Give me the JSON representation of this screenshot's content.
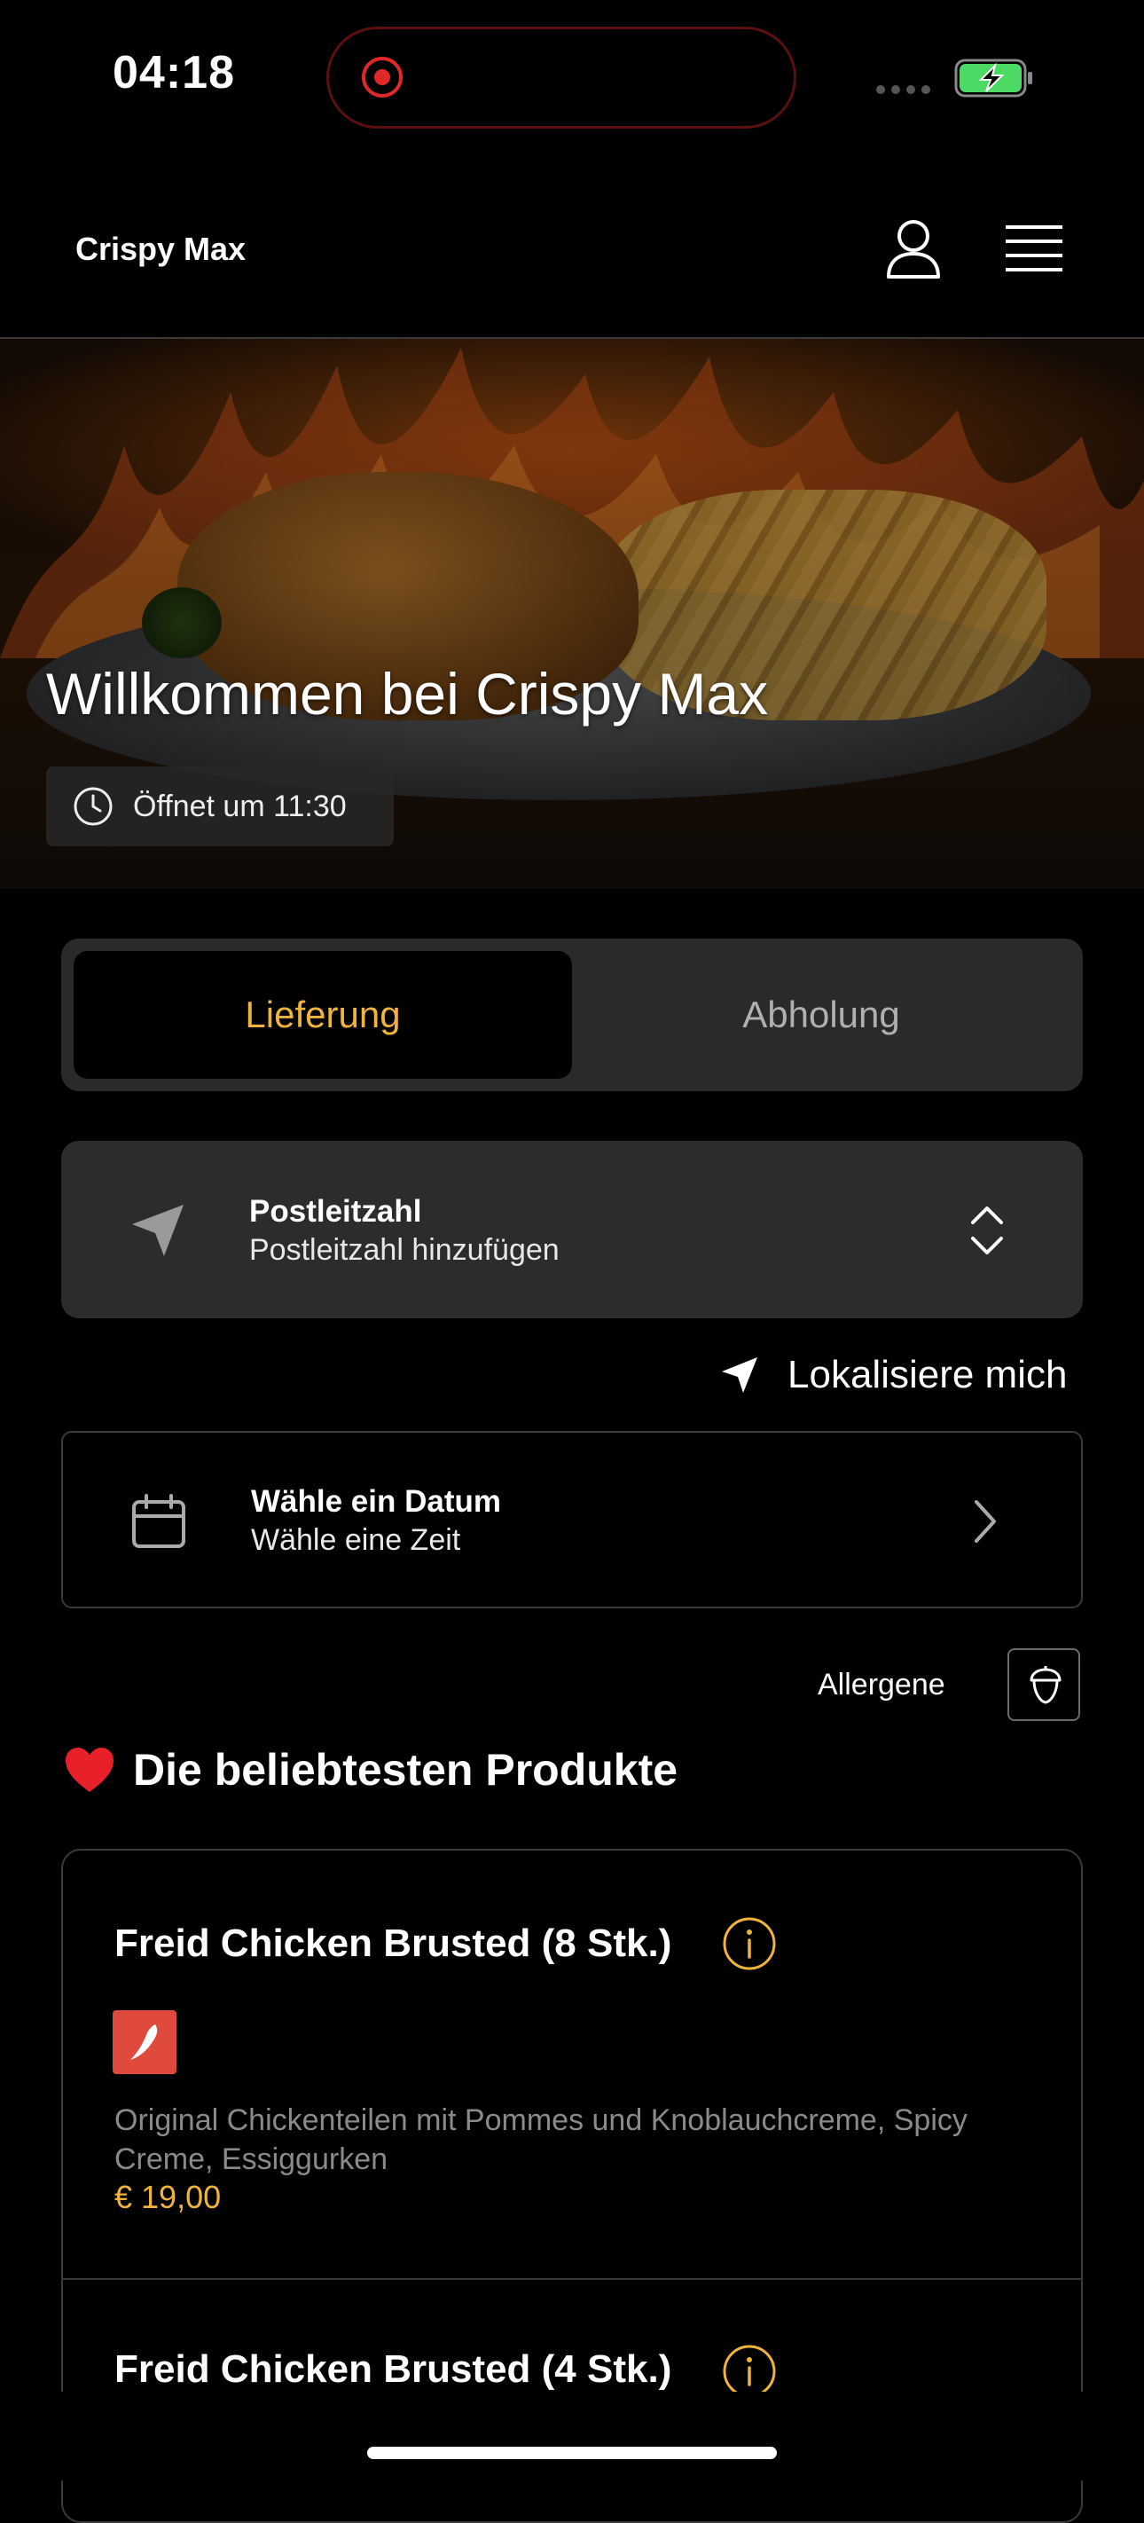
{
  "status_bar": {
    "time": "04:18"
  },
  "header": {
    "brand": "Crispy Max"
  },
  "hero": {
    "title": "Willkommen bei Crispy Max",
    "opening": "Öffnet um 11:30"
  },
  "order_mode": {
    "active": "Lieferung",
    "inactive": "Abholung"
  },
  "postcode": {
    "title": "Postleitzahl",
    "placeholder": "Postleitzahl hinzufügen"
  },
  "localize": {
    "label": "Lokalisiere mich"
  },
  "date": {
    "title": "Wähle ein Datum",
    "subtitle": "Wähle eine Zeit"
  },
  "allergens": {
    "label": "Allergene"
  },
  "section": {
    "title": "Die beliebtesten Produkte"
  },
  "products": [
    {
      "name": "Freid Chicken Brusted (8 Stk.)",
      "description": "Original Chickenteilen mit Pommes und Knoblauchcreme, Spicy Creme, Essiggurken",
      "price": "€ 19,00"
    },
    {
      "name": "Freid Chicken Brusted (4 Stk.)"
    }
  ],
  "colors": {
    "accent": "#f0b43c",
    "background": "#000000",
    "chili_badge": "#e04a3c",
    "battery": "#4cd964"
  }
}
